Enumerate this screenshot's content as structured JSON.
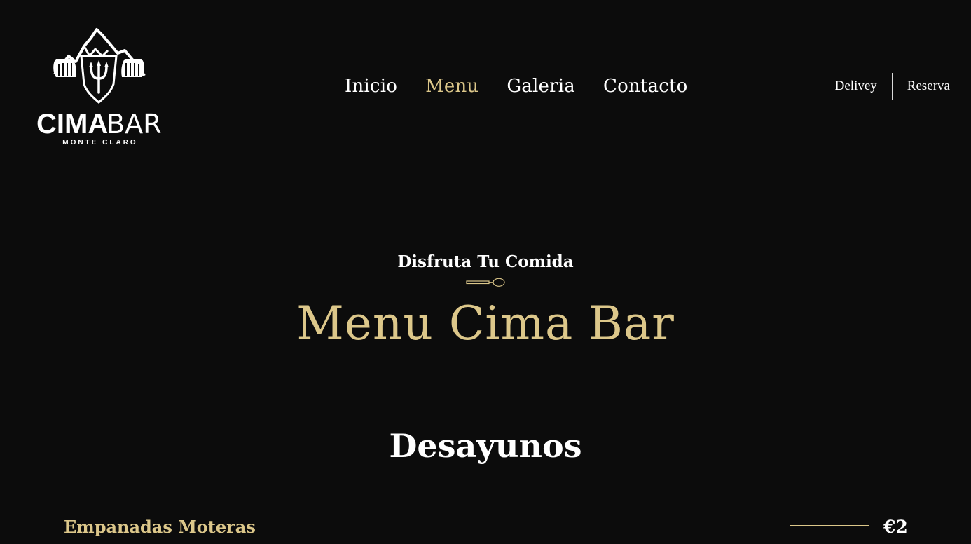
{
  "brand": {
    "name_bold": "CIMA",
    "name_light": "BAR",
    "tagline": "MONTE CLARO"
  },
  "nav": {
    "items": [
      {
        "label": "Inicio",
        "active": false
      },
      {
        "label": "Menu",
        "active": true
      },
      {
        "label": "Galeria",
        "active": false
      },
      {
        "label": "Contacto",
        "active": false
      }
    ]
  },
  "actions": {
    "delivery": "Delivey",
    "reserve": "Reserva"
  },
  "hero": {
    "subtitle": "Disfruta Tu Comida",
    "title": "Menu Cima Bar"
  },
  "section": {
    "title": "Desayunos",
    "items": [
      {
        "name": "Empanadas Moteras",
        "price": "€2"
      }
    ]
  },
  "colors": {
    "background": "#0c0c0c",
    "accent": "#dcc78a",
    "text": "#ffffff"
  },
  "icons": {
    "logo": "mountain-trident-logo",
    "divider": "spoon-icon"
  }
}
